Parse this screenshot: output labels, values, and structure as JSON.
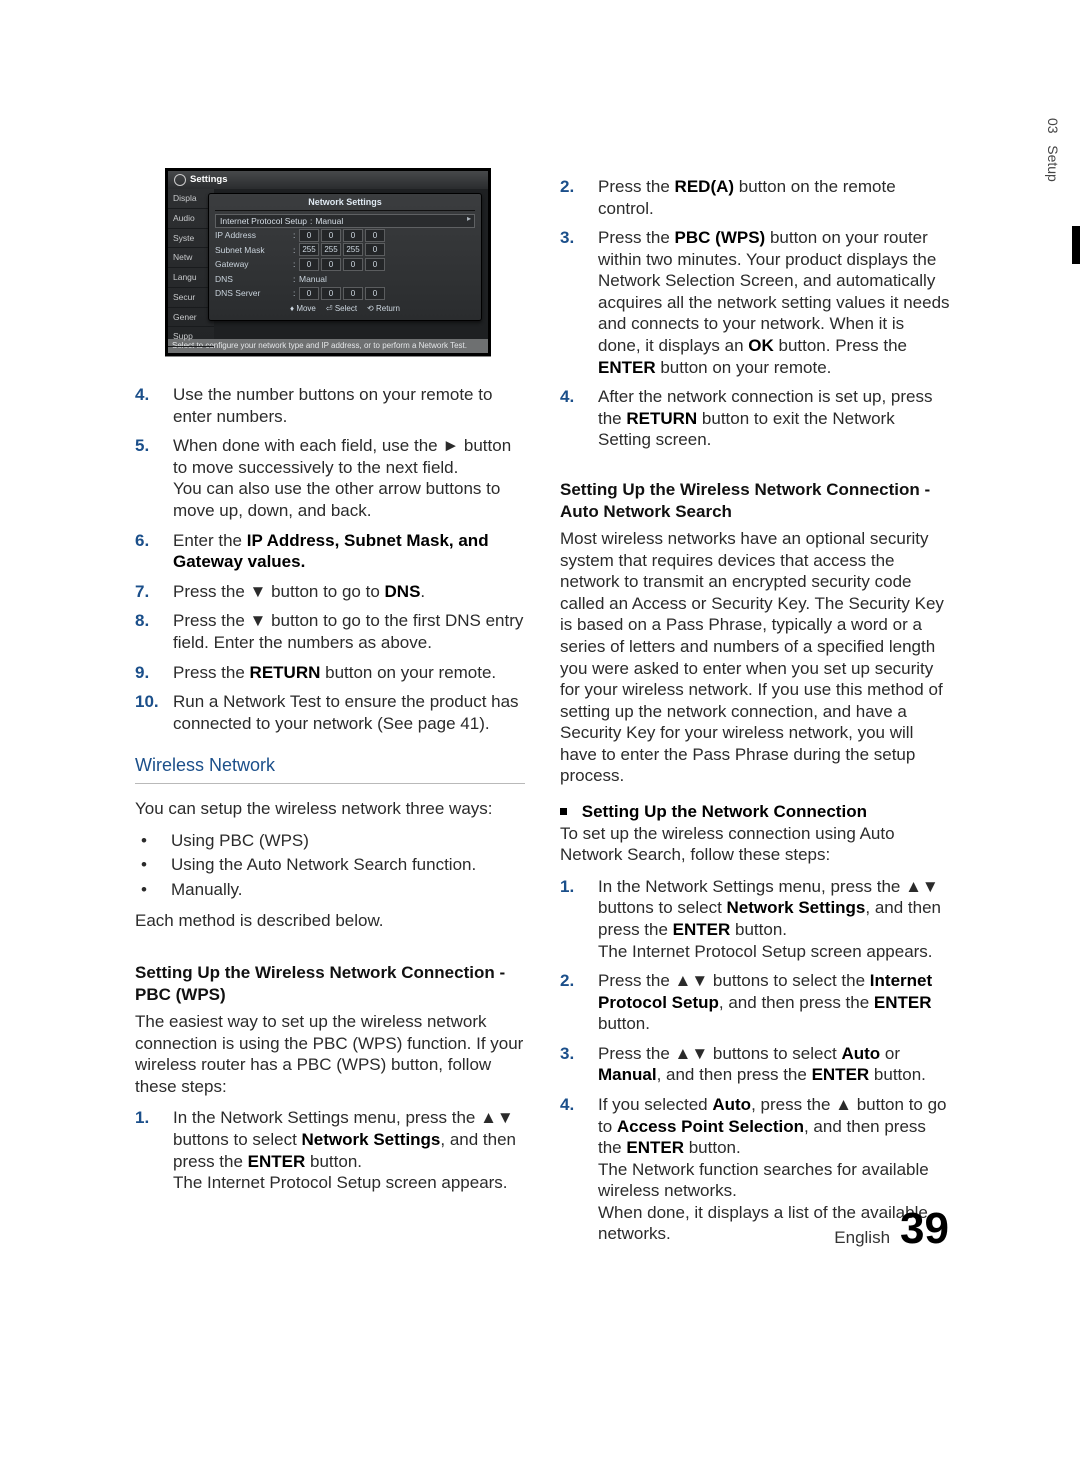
{
  "side": {
    "chapter": "03",
    "label": "Setup"
  },
  "footer": {
    "lang": "English",
    "page": "39"
  },
  "settings_panel": {
    "window_title": "Settings",
    "panel_title": "Network Settings",
    "sidebar_items": [
      "Displa",
      "Audio",
      "Syste",
      "Netw",
      "Langu",
      "Secur",
      "Gener",
      "Supp"
    ],
    "row_protocol_label": "Internet Protocol Setup",
    "row_protocol_value": "Manual",
    "ip_address_label": "IP Address",
    "ip_address_values": [
      "0",
      "0",
      "0",
      "0"
    ],
    "subnet_label": "Subnet Mask",
    "subnet_values": [
      "255",
      "255",
      "255",
      "0"
    ],
    "gateway_label": "Gateway",
    "gateway_values": [
      "0",
      "0",
      "0",
      "0"
    ],
    "dns_label": "DNS",
    "dns_value": "Manual",
    "dns_server_label": "DNS Server",
    "dns_server_values": [
      "0",
      "0",
      "0",
      "0"
    ],
    "hint_move": "Move",
    "hint_select": "Select",
    "hint_return": "Return",
    "footer_text": "Select to configure your network type and IP address, or to perform a Network Test."
  },
  "left_list": {
    "n4": "4.",
    "t4": "Use the number buttons on your remote to enter numbers.",
    "n5": "5.",
    "t5a": "When done with each field, use the ► button to move successively to the next field.",
    "t5b": "You can also use the other arrow buttons to move up, down, and back.",
    "n6": "6.",
    "t6_pre": "Enter the ",
    "t6_ip": "IP Address",
    "t6_sep1": ", ",
    "t6_sm": "Subnet Mask",
    "t6_sep2": ", and ",
    "t6_gw": "Gateway",
    "t6_post": " values.",
    "n7": "7.",
    "t7_pre": "Press the ▼ button to go to ",
    "t7_dns": "DNS",
    "t7_post": ".",
    "n8": "8.",
    "t8": "Press the ▼ button to go to the first DNS entry field. Enter the numbers as above.",
    "n9": "9.",
    "t9_pre": "Press the ",
    "t9_return": "RETURN",
    "t9_post": " button on your remote.",
    "n10": "10.",
    "t10": "Run a Network Test to ensure the product has connected to your network (See page 41)."
  },
  "wireless": {
    "heading": "Wireless Network",
    "intro": "You can setup the wireless network three ways:",
    "b1": "Using PBC (WPS)",
    "b2": "Using the Auto Network Search function.",
    "b3": "Manually.",
    "outro": "Each method is described below."
  },
  "pbc": {
    "heading": "Setting Up the Wireless Network Connection - PBC (WPS)",
    "intro": "The easiest way to set up the wireless network connection is using the PBC (WPS) function. If your wireless router has a PBC (WPS) button, follow these steps:",
    "n1": "1.",
    "t1_pre": "In the Network Settings menu, press the ▲▼ buttons to select ",
    "t1_ns": "Network Settings",
    "t1_mid": ", and then press the ",
    "t1_enter": "ENTER",
    "t1_post": " button.",
    "t1_line2": "The Internet Protocol Setup screen appears."
  },
  "right_top": {
    "n2": "2.",
    "t2_pre": "Press the ",
    "t2_red": "RED(A)",
    "t2_post": " button on the remote control.",
    "n3": "3.",
    "t3_pre": "Press the ",
    "t3_pbc": "PBC (WPS)",
    "t3_mid1": " button on your router within two minutes. Your product displays the Network Selection Screen, and automatically acquires all the network setting values it needs and connects to your network. When it is done, it displays an ",
    "t3_ok": "OK",
    "t3_mid2": " button. Press the ",
    "t3_enter": "ENTER",
    "t3_post": " button on your remote.",
    "n4": "4.",
    "t4_pre": "After the network connection is set up, press the ",
    "t4_return": "RETURN",
    "t4_post": " button to exit the Network Setting screen."
  },
  "auto": {
    "heading": "Setting Up the Wireless Network Connection - Auto Network Search",
    "intro": "Most wireless networks have an optional security system that requires devices that access the network to transmit an encrypted security code called an Access or Security Key. The Security Key is based on a Pass Phrase, typically a word or a series of letters and numbers of a specified length you were asked to enter when you set up security for your wireless network. If you use this method of setting up the network connection, and have a Security Key for your wireless network, you will have to enter the Pass Phrase during the setup process.",
    "sub_heading": "Setting Up the Network Connection",
    "sub_intro": "To set up the wireless connection using Auto Network Search, follow these steps:",
    "n1": "1.",
    "t1_pre": "In the Network Settings menu, press the ▲▼ buttons to select ",
    "t1_ns": "Network Settings",
    "t1_mid": ", and then press the ",
    "t1_enter": "ENTER",
    "t1_post": " button.",
    "t1_line2": "The Internet Protocol Setup screen appears.",
    "n2": "2.",
    "t2_pre": "Press the ▲▼ buttons to select the ",
    "t2_ips": "Internet Protocol Setup",
    "t2_mid": ", and then press the ",
    "t2_enter": "ENTER",
    "t2_post": " button.",
    "n3": "3.",
    "t3_pre": "Press the ▲▼ buttons to select ",
    "t3_auto": "Auto",
    "t3_or": " or ",
    "t3_manual": "Manual",
    "t3_mid": ", and then press the ",
    "t3_enter": "ENTER",
    "t3_post": " button.",
    "n4": "4.",
    "t4_pre": "If you selected ",
    "t4_auto": "Auto",
    "t4_mid1": ", press the ▲ button to go to ",
    "t4_aps": "Access Point Selection",
    "t4_mid2": ", and then press the ",
    "t4_enter": "ENTER",
    "t4_post": " button.",
    "t4_line2": "The Network function searches for available wireless networks.",
    "t4_line3": "When done, it displays a list of the available networks."
  }
}
